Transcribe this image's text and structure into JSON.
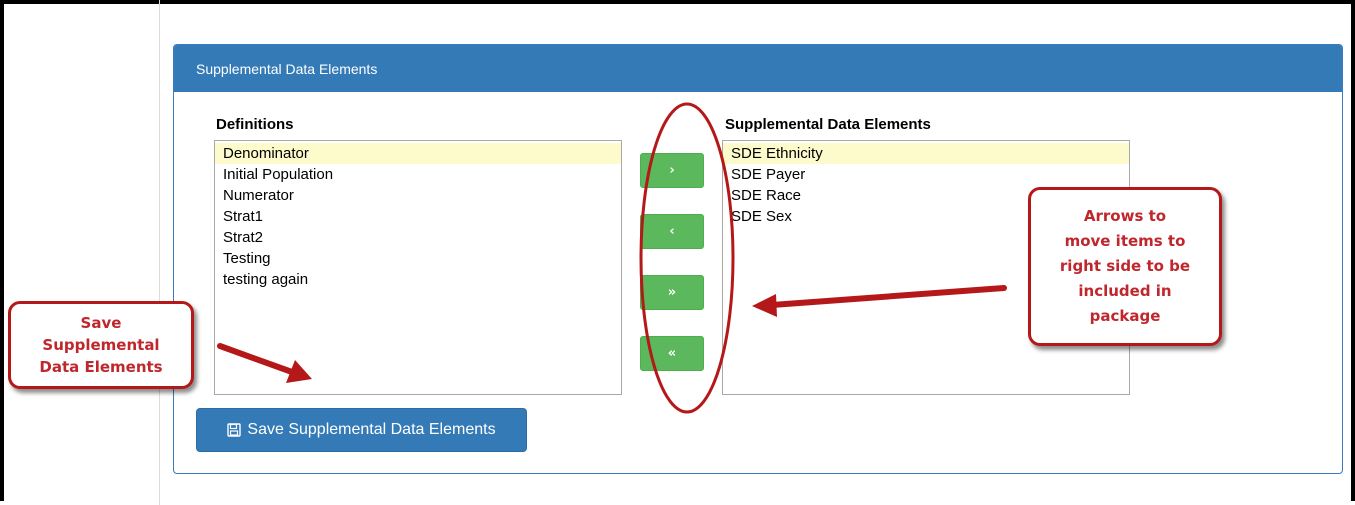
{
  "panel": {
    "heading": "Supplemental Data Elements",
    "definitions_label": "Definitions",
    "sde_label": "Supplemental Data Elements",
    "definitions": [
      "Denominator",
      "Initial Population",
      "Numerator",
      "Strat1",
      "Strat2",
      "Testing",
      "testing again"
    ],
    "definitions_selected": "Denominator",
    "sde_items": [
      "SDE Ethnicity",
      "SDE Payer",
      "SDE Race",
      "SDE Sex"
    ],
    "sde_selected": "SDE Ethnicity"
  },
  "buttons": {
    "move_right": "›",
    "move_left": "‹",
    "move_all_right": "»",
    "move_all_left": "«",
    "save_label": "Save Supplemental Data Elements",
    "save_icon": "floppy-disk-icon"
  },
  "callouts": {
    "save": "Save\nSupplemental\nData Elements",
    "arrows": "Arrows to\nmove items to\nright side to be\nincluded in\npackage"
  },
  "colors": {
    "panel_heading": "#337ab7",
    "move_button": "#5cb85c",
    "selected_item": "#fdfacc",
    "annotation": "#c0272d"
  }
}
